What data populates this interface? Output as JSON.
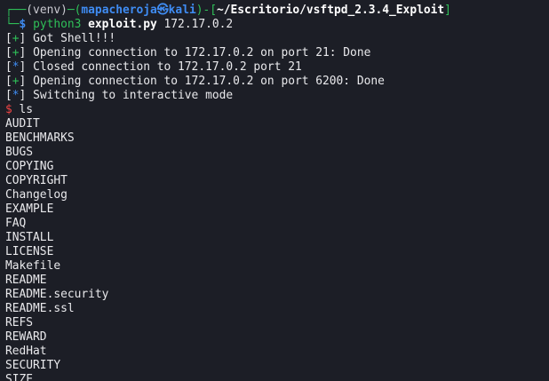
{
  "colors": {
    "background": "#1c1e26",
    "text": "#e9e9ec",
    "prompt_green": "#2fbf58",
    "user_blue": "#3f8cf3",
    "error_red": "#ef4444"
  },
  "prompt": {
    "frame_top": "┌──",
    "venv": "(venv)",
    "dash": "─",
    "user_host_open": "(",
    "user": "mapacheroja",
    "at_symbol": "㉿",
    "host": "kali",
    "user_host_close": ")",
    "path_open": "-[",
    "path": "~/Escritorio/vsftpd_2.3.4_Exploit",
    "path_close": "]",
    "frame_bottom": "└─",
    "symbol": "$",
    "command_name": "python3",
    "command_script": "exploit.py",
    "command_args": "172.17.0.2"
  },
  "log_lines": [
    {
      "marker": "+",
      "text": "Got Shell!!!"
    },
    {
      "marker": "+",
      "text": "Opening connection to 172.17.0.2 on port 21: Done"
    },
    {
      "marker": "*",
      "text": "Closed connection to 172.17.0.2 port 21"
    },
    {
      "marker": "+",
      "text": "Opening connection to 172.17.0.2 on port 6200: Done"
    },
    {
      "marker": "*",
      "text": "Switching to interactive mode"
    }
  ],
  "shell": {
    "symbol": "$",
    "command": "ls"
  },
  "ls_output": [
    "AUDIT",
    "BENCHMARKS",
    "BUGS",
    "COPYING",
    "COPYRIGHT",
    "Changelog",
    "EXAMPLE",
    "FAQ",
    "INSTALL",
    "LICENSE",
    "Makefile",
    "README",
    "README.security",
    "README.ssl",
    "REFS",
    "REWARD",
    "RedHat",
    "SECURITY",
    "SIZE"
  ]
}
